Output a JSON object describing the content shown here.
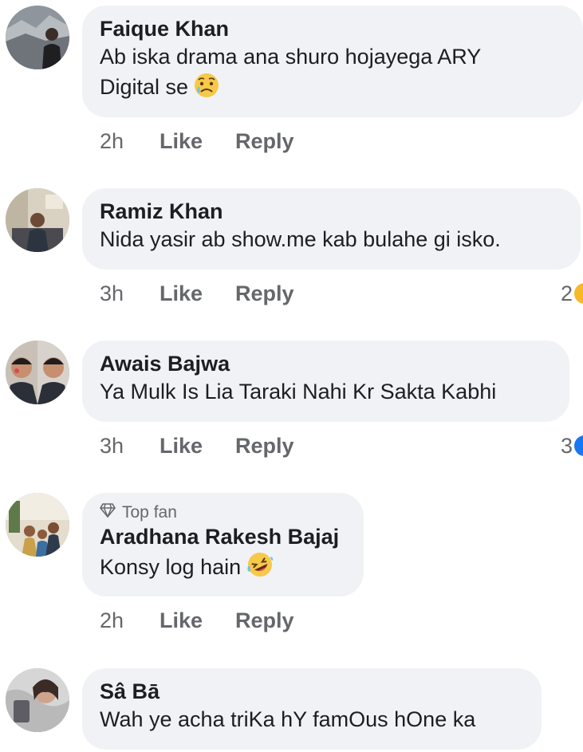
{
  "comments": [
    {
      "author": "Faique Khan",
      "text_line1": "Ab iska drama ana shuro hojayega ARY",
      "text_line2": "Digital se",
      "emoji": "sad-sweat-emoji",
      "time": "2h",
      "like_label": "Like",
      "reply_label": "Reply"
    },
    {
      "author": "Ramiz Khan",
      "text": "Nida yasir ab show.me kab bulahe gi isko.",
      "time": "3h",
      "like_label": "Like",
      "reply_label": "Reply",
      "reaction_count": "2",
      "reaction_color": "#f7b928"
    },
    {
      "author": "Awais Bajwa",
      "text": "Ya Mulk Is Lia Taraki Nahi Kr Sakta Kabhi",
      "time": "3h",
      "like_label": "Like",
      "reply_label": "Reply",
      "reaction_count": "3",
      "reaction_color": "#1877f2"
    },
    {
      "badge": "Top fan",
      "badge_icon": "diamond-icon",
      "author": "Aradhana Rakesh Bajaj",
      "text": "Konsy log hain",
      "emoji": "rolling-laughing-emoji",
      "time": "2h",
      "like_label": "Like",
      "reply_label": "Reply"
    },
    {
      "author": "Sâ Bā",
      "text": "Wah ye acha triKa hY famOus hOne ka"
    }
  ],
  "colors": {
    "bubble": "#f0f2f5",
    "name": "#1c1e21",
    "meta": "#65676b"
  }
}
